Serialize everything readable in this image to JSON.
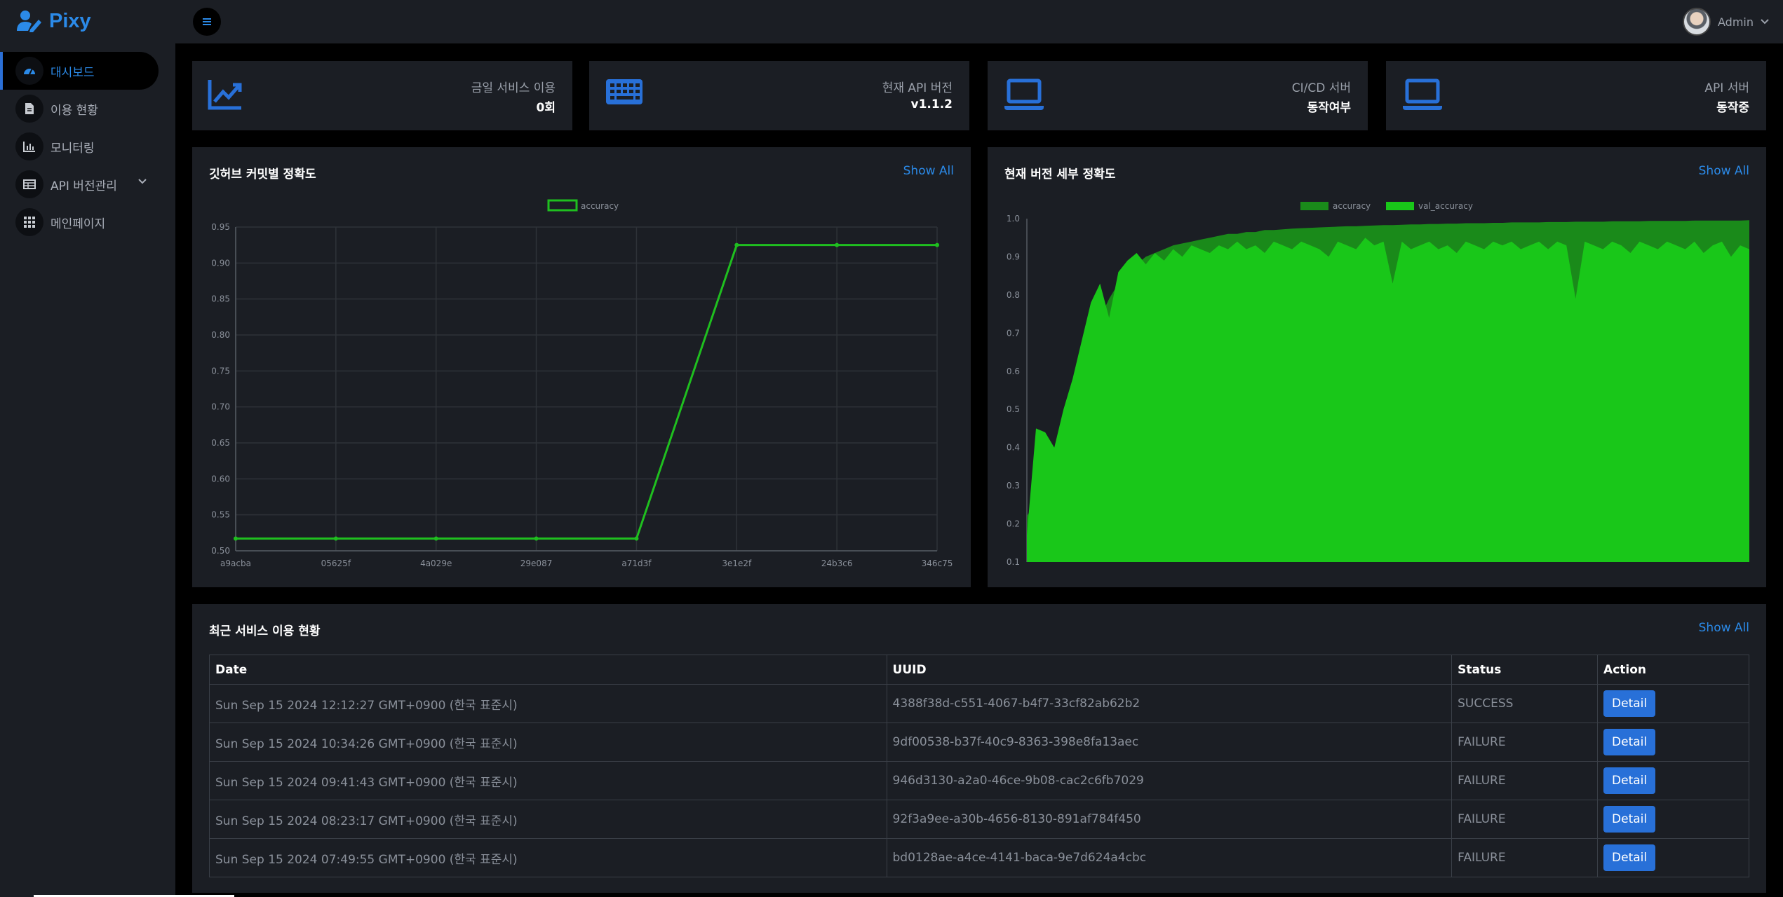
{
  "app": {
    "name": "Pixy"
  },
  "sidebar": {
    "items": [
      {
        "label": "대시보드",
        "icon": "dashboard-gauge-icon",
        "active": true
      },
      {
        "label": "이용 현황",
        "icon": "document-icon"
      },
      {
        "label": "모니터링",
        "icon": "bar-chart-icon"
      },
      {
        "label": "API 버전관리",
        "icon": "table-icon",
        "has_submenu": true
      },
      {
        "label": "메인페이지",
        "icon": "grid-icon"
      }
    ]
  },
  "topbar": {
    "user_name": "Admin"
  },
  "stats": [
    {
      "label": "금일 서비스 이용",
      "value": "0회",
      "icon": "chart-line-icon"
    },
    {
      "label": "현재 API 버전",
      "value": "v1.1.2",
      "icon": "keyboard-icon"
    },
    {
      "label": "CI/CD 서버",
      "value": "동작여부",
      "icon": "laptop-icon"
    },
    {
      "label": "API 서버",
      "value": "동작중",
      "icon": "laptop-icon"
    }
  ],
  "commit_chart": {
    "title": "깃허브 커밋별 정확도",
    "show_all": "Show All"
  },
  "version_chart": {
    "title": "현재 버전 세부 정확도",
    "show_all": "Show All"
  },
  "chart_data": [
    {
      "type": "line",
      "title": "깃허브 커밋별 정확도",
      "categories": [
        "a9acba",
        "05625f",
        "4a029e",
        "29e087",
        "a71d3f",
        "3e1e2f",
        "24b3c6",
        "346c75"
      ],
      "series": [
        {
          "name": "accuracy",
          "values": [
            0.517,
            0.517,
            0.517,
            0.517,
            0.517,
            0.925,
            0.925,
            0.925
          ]
        }
      ],
      "ylim": [
        0.5,
        0.95
      ],
      "yticks": [
        "0.50",
        "0.55",
        "0.60",
        "0.65",
        "0.70",
        "0.75",
        "0.80",
        "0.85",
        "0.90",
        "0.95"
      ],
      "grid": true,
      "legend": "top",
      "colors": {
        "accuracy": "#1fbf1f"
      }
    },
    {
      "type": "area",
      "title": "현재 버전 세부 정확도",
      "ylim": [
        0.1,
        1.0
      ],
      "yticks": [
        "0.1",
        "0.2",
        "0.3",
        "0.4",
        "0.5",
        "0.6",
        "0.7",
        "0.8",
        "0.9",
        "1.0"
      ],
      "grid": false,
      "legend": "top",
      "series": [
        {
          "name": "accuracy",
          "color": "#1a8a1a",
          "values": [
            0.22,
            0.26,
            0.3,
            0.36,
            0.43,
            0.52,
            0.6,
            0.68,
            0.74,
            0.79,
            0.83,
            0.86,
            0.88,
            0.9,
            0.91,
            0.92,
            0.93,
            0.935,
            0.94,
            0.945,
            0.95,
            0.955,
            0.96,
            0.96,
            0.965,
            0.965,
            0.97,
            0.97,
            0.972,
            0.974,
            0.975,
            0.976,
            0.977,
            0.978,
            0.979,
            0.98,
            0.98,
            0.981,
            0.982,
            0.983,
            0.983,
            0.984,
            0.985,
            0.985,
            0.986,
            0.986,
            0.987,
            0.987,
            0.988,
            0.988,
            0.988,
            0.989,
            0.989,
            0.99,
            0.99,
            0.99,
            0.99,
            0.991,
            0.991,
            0.991,
            0.992,
            0.992,
            0.992,
            0.992,
            0.993,
            0.993,
            0.993,
            0.993,
            0.994,
            0.994,
            0.994,
            0.994,
            0.994,
            0.995,
            0.995,
            0.995,
            0.995,
            0.995,
            0.995,
            0.996
          ]
        },
        {
          "name": "val_accuracy",
          "color": "#19c719",
          "values": [
            0.17,
            0.45,
            0.44,
            0.4,
            0.5,
            0.58,
            0.68,
            0.78,
            0.83,
            0.74,
            0.86,
            0.89,
            0.91,
            0.88,
            0.91,
            0.89,
            0.92,
            0.9,
            0.93,
            0.92,
            0.91,
            0.93,
            0.92,
            0.94,
            0.92,
            0.93,
            0.91,
            0.94,
            0.93,
            0.92,
            0.94,
            0.93,
            0.92,
            0.9,
            0.94,
            0.93,
            0.92,
            0.95,
            0.93,
            0.94,
            0.83,
            0.94,
            0.92,
            0.93,
            0.94,
            0.92,
            0.93,
            0.91,
            0.94,
            0.93,
            0.92,
            0.94,
            0.93,
            0.94,
            0.92,
            0.93,
            0.94,
            0.92,
            0.94,
            0.93,
            0.79,
            0.94,
            0.93,
            0.92,
            0.94,
            0.93,
            0.91,
            0.94,
            0.93,
            0.92,
            0.94,
            0.93,
            0.92,
            0.94,
            0.91,
            0.93,
            0.94,
            0.9,
            0.93,
            0.92
          ]
        }
      ]
    }
  ],
  "recent": {
    "title": "최근 서비스 이용 현황",
    "show_all": "Show All",
    "columns": [
      "Date",
      "UUID",
      "Status",
      "Action"
    ],
    "rows": [
      {
        "date": "Sun Sep 15 2024 12:12:27 GMT+0900 (한국 표준시)",
        "uuid": "4388f38d-c551-4067-b4f7-33cf82ab62b2",
        "status": "SUCCESS",
        "action": "Detail"
      },
      {
        "date": "Sun Sep 15 2024 10:34:26 GMT+0900 (한국 표준시)",
        "uuid": "9df00538-b37f-40c9-8363-398e8fa13aec",
        "status": "FAILURE",
        "action": "Detail"
      },
      {
        "date": "Sun Sep 15 2024 09:41:43 GMT+0900 (한국 표준시)",
        "uuid": "946d3130-a2a0-46ce-9b08-cac2c6fb7029",
        "status": "FAILURE",
        "action": "Detail"
      },
      {
        "date": "Sun Sep 15 2024 08:23:17 GMT+0900 (한국 표준시)",
        "uuid": "92f3a9ee-a30b-4656-8130-891af784f450",
        "status": "FAILURE",
        "action": "Detail"
      },
      {
        "date": "Sun Sep 15 2024 07:49:55 GMT+0900 (한국 표준시)",
        "uuid": "bd0128ae-a4ce-4141-baca-9e7d624a4cbc",
        "status": "FAILURE",
        "action": "Detail"
      }
    ]
  }
}
